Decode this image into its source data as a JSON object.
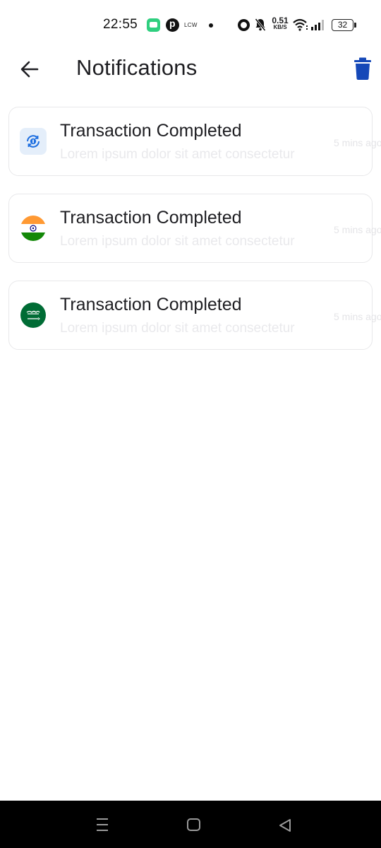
{
  "status_bar": {
    "time": "22:55",
    "carrier_label": "LCW",
    "net_speed_value": "0.51",
    "net_speed_unit": "KB/S",
    "battery": "32",
    "icons": [
      "chat-app-icon",
      "pinterest-icon",
      "dot-icon",
      "alarm-icon",
      "bell-muted-icon",
      "wifi-icon",
      "signal-icon",
      "battery-icon"
    ]
  },
  "header": {
    "title": "Notifications",
    "back_icon": "arrow-left-icon",
    "delete_icon": "trash-icon"
  },
  "colors": {
    "accent": "#1548b8",
    "title_text": "#1e1e22",
    "subtitle_text": "#e9e9ec",
    "card_border": "#e8e8ea"
  },
  "notifications": [
    {
      "icon": "transaction-icon",
      "title": "Transaction Completed",
      "subtitle": "Lorem ipsum dolor sit amet consectetur",
      "time": "5 mins ago"
    },
    {
      "icon": "india-flag-icon",
      "title": "Transaction Completed",
      "subtitle": "Lorem ipsum dolor sit amet consectetur",
      "time": "5 mins ago"
    },
    {
      "icon": "saudi-flag-icon",
      "title": "Transaction Completed",
      "subtitle": "Lorem ipsum dolor sit amet consectetur",
      "time": "5 mins ago"
    }
  ],
  "nav_bar": {
    "icons": [
      "menu-icon",
      "home-icon",
      "back-triangle-icon"
    ]
  }
}
